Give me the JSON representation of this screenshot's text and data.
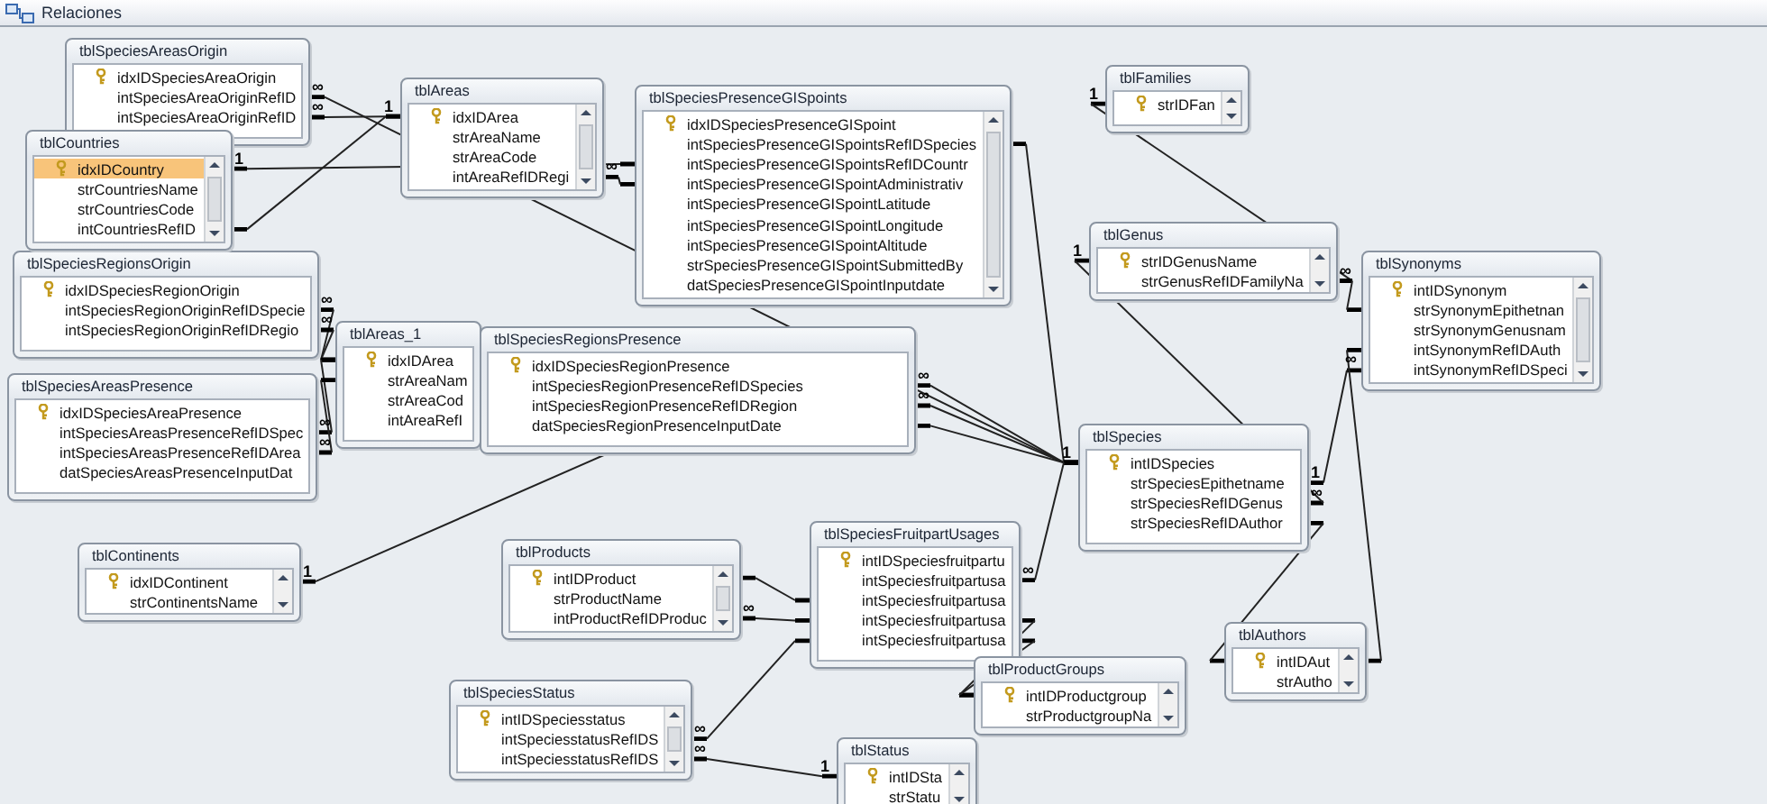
{
  "window": {
    "title": "Relaciones"
  },
  "tables": [
    {
      "title": "tblSpeciesAreasOrigin",
      "scrollbar": false,
      "fields": [
        {
          "name": "idxIDSpeciesAreaOrigin",
          "key": true,
          "selected": false
        },
        {
          "name": "intSpeciesAreaOriginRefID",
          "key": false,
          "selected": false,
          "right_mark": "∞"
        },
        {
          "name": "intSpeciesAreaOriginRefID",
          "key": false,
          "selected": false,
          "right_mark": "∞"
        }
      ]
    },
    {
      "title": "tblCountries",
      "scrollbar": true,
      "fields": [
        {
          "name": "idxIDCountry",
          "key": true,
          "selected": true,
          "right_mark": "1"
        },
        {
          "name": "strCountriesName",
          "key": false,
          "selected": false
        },
        {
          "name": "strCountriesCode",
          "key": false,
          "selected": false
        },
        {
          "name": "intCountriesRefID",
          "key": false,
          "selected": false
        }
      ]
    },
    {
      "title": "tblSpeciesRegionsOrigin",
      "scrollbar": false,
      "fields": [
        {
          "name": "idxIDSpeciesRegionOrigin",
          "key": true,
          "selected": false
        },
        {
          "name": "intSpeciesRegionOriginRefIDSpecie",
          "key": false,
          "selected": false,
          "right_mark": "∞"
        },
        {
          "name": "intSpeciesRegionOriginRefIDRegio",
          "key": false,
          "selected": false,
          "right_mark": "∞"
        }
      ]
    },
    {
      "title": "tblAreas",
      "scrollbar": true,
      "fields": [
        {
          "name": "idxIDArea",
          "key": true,
          "selected": false,
          "left_mark": "1"
        },
        {
          "name": "strAreaName",
          "key": false,
          "selected": false
        },
        {
          "name": "strAreaCode",
          "key": false,
          "selected": false
        },
        {
          "name": "intAreaRefIDRegi",
          "key": false,
          "selected": false,
          "right_mark": "∞"
        }
      ]
    },
    {
      "title": "tblSpeciesPresenceGISpoints",
      "scrollbar": true,
      "fields": [
        {
          "name": "idxIDSpeciesPresenceGISpoint",
          "key": true,
          "selected": false
        },
        {
          "name": "intSpeciesPresenceGISpointsRefIDSpecies",
          "key": false,
          "selected": false
        },
        {
          "name": "intSpeciesPresenceGISpointsRefIDCountr",
          "key": false,
          "selected": false
        },
        {
          "name": "intSpeciesPresenceGISpointAdministrativ",
          "key": false,
          "selected": false
        },
        {
          "name": "intSpeciesPresenceGISpointLatitude",
          "key": false,
          "selected": false
        },
        {
          "name": "intSpeciesPresenceGISpointLongitude",
          "key": false,
          "selected": false
        },
        {
          "name": "intSpeciesPresenceGISpointAltitude",
          "key": false,
          "selected": false
        },
        {
          "name": "strSpeciesPresenceGISpointSubmittedBy",
          "key": false,
          "selected": false
        },
        {
          "name": "datSpeciesPresenceGISpointInputdate",
          "key": false,
          "selected": false
        }
      ]
    },
    {
      "title": "tblAreas_1",
      "scrollbar": false,
      "fields": [
        {
          "name": "idxIDArea",
          "key": true,
          "selected": false
        },
        {
          "name": "strAreaNam",
          "key": false,
          "selected": false
        },
        {
          "name": "strAreaCod",
          "key": false,
          "selected": false
        },
        {
          "name": "intAreaRefI",
          "key": false,
          "selected": false
        }
      ]
    },
    {
      "title": "tblSpeciesRegionsPresence",
      "scrollbar": false,
      "fields": [
        {
          "name": "idxIDSpeciesRegionPresence",
          "key": true,
          "selected": false
        },
        {
          "name": "intSpeciesRegionPresenceRefIDSpecies",
          "key": false,
          "selected": false,
          "right_mark": "∞"
        },
        {
          "name": "intSpeciesRegionPresenceRefIDRegion",
          "key": false,
          "selected": false,
          "right_mark": "∞"
        },
        {
          "name": "datSpeciesRegionPresenceInputDate",
          "key": false,
          "selected": false
        }
      ]
    },
    {
      "title": "tblSpeciesAreasPresence",
      "scrollbar": false,
      "fields": [
        {
          "name": "idxIDSpeciesAreaPresence",
          "key": true,
          "selected": false
        },
        {
          "name": "intSpeciesAreasPresenceRefIDSpec",
          "key": false,
          "selected": false,
          "right_mark": "∞"
        },
        {
          "name": "intSpeciesAreasPresenceRefIDArea",
          "key": false,
          "selected": false,
          "right_mark": "∞"
        },
        {
          "name": "datSpeciesAreasPresenceInputDat",
          "key": false,
          "selected": false
        }
      ]
    },
    {
      "title": "tblContinents",
      "scrollbar": true,
      "fields": [
        {
          "name": "idxIDContinent",
          "key": true,
          "selected": false,
          "right_mark": "1"
        },
        {
          "name": "strContinentsName",
          "key": false,
          "selected": false
        }
      ]
    },
    {
      "title": "tblProducts",
      "scrollbar": true,
      "fields": [
        {
          "name": "intIDProduct",
          "key": true,
          "selected": false
        },
        {
          "name": "strProductName",
          "key": false,
          "selected": false
        },
        {
          "name": "intProductRefIDProduc",
          "key": false,
          "selected": false,
          "right_mark": "∞"
        }
      ]
    },
    {
      "title": "tblSpeciesFruitpartUsages",
      "scrollbar": false,
      "fields": [
        {
          "name": "intIDSpeciesfruitpartu",
          "key": true,
          "selected": false
        },
        {
          "name": "intSpeciesfruitpartusa",
          "key": false,
          "selected": false,
          "right_mark": "∞"
        },
        {
          "name": "intSpeciesfruitpartusa",
          "key": false,
          "selected": false
        },
        {
          "name": "intSpeciesfruitpartusa",
          "key": false,
          "selected": false
        },
        {
          "name": "intSpeciesfruitpartusa",
          "key": false,
          "selected": false
        }
      ]
    },
    {
      "title": "tblSpeciesStatus",
      "scrollbar": true,
      "fields": [
        {
          "name": "intIDSpeciesstatus",
          "key": true,
          "selected": false
        },
        {
          "name": "intSpeciesstatusRefIDS",
          "key": false,
          "selected": false,
          "right_mark": "∞"
        },
        {
          "name": "intSpeciesstatusRefIDS",
          "key": false,
          "selected": false,
          "right_mark": "∞"
        }
      ]
    },
    {
      "title": "tblStatus",
      "scrollbar": true,
      "fields": [
        {
          "name": "intIDSta",
          "key": true,
          "selected": false,
          "left_mark": "1"
        },
        {
          "name": "strStatu",
          "key": false,
          "selected": false
        }
      ]
    },
    {
      "title": "tblProductGroups",
      "scrollbar": true,
      "fields": [
        {
          "name": "intIDProductgroup",
          "key": true,
          "selected": false
        },
        {
          "name": "strProductgroupNa",
          "key": false,
          "selected": false
        }
      ]
    },
    {
      "title": "tblFamilies",
      "scrollbar": true,
      "fields": [
        {
          "name": "strIDFan",
          "key": true,
          "selected": false,
          "left_mark": "1"
        }
      ]
    },
    {
      "title": "tblGenus",
      "scrollbar": true,
      "fields": [
        {
          "name": "strIDGenusName",
          "key": true,
          "selected": false,
          "left_mark": "1"
        },
        {
          "name": "strGenusRefIDFamilyNa",
          "key": false,
          "selected": false,
          "right_mark": "∞"
        }
      ]
    },
    {
      "title": "tblSynonyms",
      "scrollbar": true,
      "fields": [
        {
          "name": "intIDSynonym",
          "key": true,
          "selected": false
        },
        {
          "name": "strSynonymEpithetnan",
          "key": false,
          "selected": false
        },
        {
          "name": "strSynonymGenusnam",
          "key": false,
          "selected": false
        },
        {
          "name": "intSynonymRefIDAuth",
          "key": false,
          "selected": false
        },
        {
          "name": "intSynonymRefIDSpeci",
          "key": false,
          "selected": false,
          "left_mark": "∞"
        }
      ]
    },
    {
      "title": "tblSpecies",
      "scrollbar": false,
      "fields": [
        {
          "name": "intIDSpecies",
          "key": true,
          "selected": false,
          "left_mark": "1"
        },
        {
          "name": "strSpeciesEpithetname",
          "key": false,
          "selected": false,
          "right_mark": "1"
        },
        {
          "name": "strSpeciesRefIDGenus",
          "key": false,
          "selected": false,
          "right_mark": "∞"
        },
        {
          "name": "strSpeciesRefIDAuthor",
          "key": false,
          "selected": false
        }
      ]
    },
    {
      "title": "tblAuthors",
      "scrollbar": true,
      "fields": [
        {
          "name": "intIDAut",
          "key": true,
          "selected": false
        },
        {
          "name": "strAutho",
          "key": false,
          "selected": false
        }
      ]
    }
  ]
}
